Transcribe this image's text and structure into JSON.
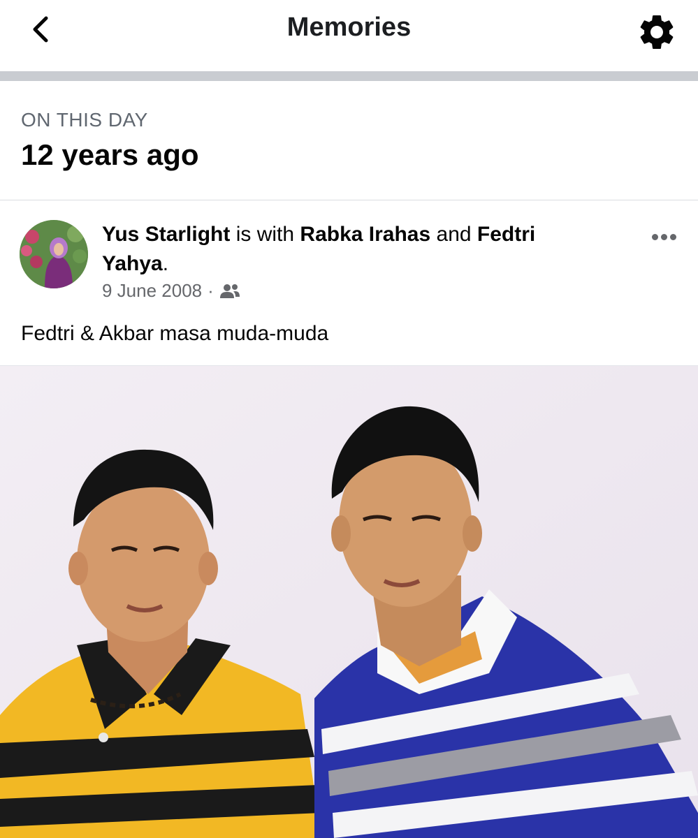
{
  "header": {
    "title": "Memories",
    "back_icon": "chevron-left-icon",
    "settings_icon": "gear-icon"
  },
  "on_this_day": {
    "label": "ON THIS DAY",
    "years_ago": "12 years ago"
  },
  "post": {
    "author": "Yus Starlight",
    "with_text": " is with ",
    "tagged_1": "Rabka Irahas",
    "and_text": " and ",
    "tagged_2": "Fedtri Yahya",
    "end_text": ".",
    "date": "9 June 2008",
    "separator": "·",
    "audience_icon": "friends-icon",
    "caption": "Fedtri & Akbar masa muda-muda",
    "more_icon": "more-dots-icon"
  },
  "colors": {
    "header_divider": "#c9ccd1",
    "meta_gray": "#65676b",
    "photo_background": "#f1ecf2"
  }
}
